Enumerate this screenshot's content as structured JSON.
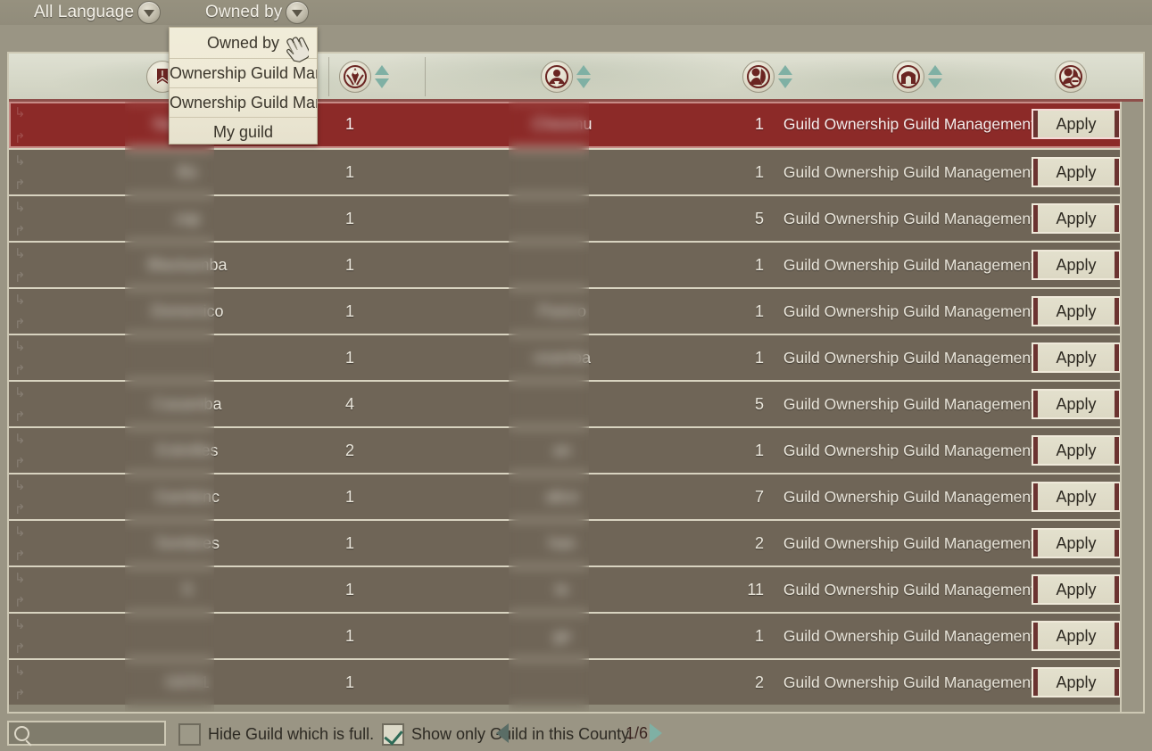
{
  "topbar": {
    "language_filter": {
      "label": "All Language",
      "icon": "chevron-down-icon"
    },
    "owned_by_filter": {
      "label": "Owned by",
      "icon": "chevron-down-icon"
    }
  },
  "dropdown": {
    "open": true,
    "items": [
      {
        "label": "Owned by"
      },
      {
        "label": "Ownership Guild Manag"
      },
      {
        "label": "Ownership Guild Man"
      },
      {
        "label": "My guild"
      }
    ]
  },
  "table": {
    "header": {
      "columns": [
        {
          "icon": "guild-banner-icon",
          "sortable": false
        },
        {
          "icon": "guild-rank-icon",
          "sortable": true
        },
        {
          "icon": "guild-world-icon",
          "sortable": true
        },
        {
          "icon": "guild-members-icon",
          "sortable": true
        },
        {
          "icon": "guild-hall-icon",
          "sortable": true
        },
        {
          "icon": "guild-restricted-icon",
          "sortable": false
        }
      ]
    },
    "apply_label": "Apply",
    "rows": [
      {
        "name": "Noussour",
        "rank": "1",
        "location": "Chesmu",
        "members": "1",
        "desc": "Guild Ownership Guild Management",
        "selected": true
      },
      {
        "name": "Bü",
        "rank": "1",
        "location": "",
        "members": "1",
        "desc": "Guild Ownership Guild Management",
        "selected": false
      },
      {
        "name": "zap",
        "rank": "1",
        "location": "",
        "members": "5",
        "desc": "Guild Ownership Guild Management",
        "selected": false
      },
      {
        "name": "Blackamba",
        "rank": "1",
        "location": "",
        "members": "1",
        "desc": "Guild Ownership Guild Management",
        "selected": false
      },
      {
        "name": "Domenico",
        "rank": "1",
        "location": "Paxico",
        "members": "1",
        "desc": "Guild Ownership Guild Management",
        "selected": false
      },
      {
        "name": "",
        "rank": "1",
        "location": "osamba",
        "members": "1",
        "desc": "Guild Ownership Guild Management",
        "selected": false
      },
      {
        "name": "Casamba",
        "rank": "4",
        "location": "",
        "members": "5",
        "desc": "Guild Ownership Guild Management",
        "selected": false
      },
      {
        "name": "Estrelles",
        "rank": "2",
        "location": "an",
        "members": "1",
        "desc": "Guild Ownership Guild Management",
        "selected": false
      },
      {
        "name": "Gambinc",
        "rank": "1",
        "location": "alice",
        "members": "7",
        "desc": "Guild Ownership Guild Management",
        "selected": false
      },
      {
        "name": "Sombres",
        "rank": "1",
        "location": "han",
        "members": "2",
        "desc": "Guild Ownership Guild Management",
        "selected": false
      },
      {
        "name": "S",
        "rank": "1",
        "location": "te",
        "members": "11",
        "desc": "Guild Ownership Guild Management",
        "selected": false
      },
      {
        "name": "",
        "rank": "1",
        "location": "ge",
        "members": "1",
        "desc": "Guild Ownership Guild Management",
        "selected": false
      },
      {
        "name": "GER1",
        "rank": "1",
        "location": "",
        "members": "2",
        "desc": "Guild Ownership Guild Management",
        "selected": false
      }
    ]
  },
  "bottombar": {
    "search": {
      "value": "",
      "placeholder": "",
      "icon": "search-icon"
    },
    "hide_full": {
      "label": "Hide Guild which is full.",
      "checked": false
    },
    "show_county": {
      "label": "Show only Guild in this County.",
      "checked": true
    },
    "pager": {
      "prev_icon": "triangle-left-icon",
      "page": "1/6",
      "next_icon": "triangle-right-icon"
    }
  },
  "colors": {
    "selected_row": "#8c2a28",
    "row": "#6f6557",
    "panel_border": "#cdc8b4",
    "header_band": "#d6d8c8",
    "accent_teal": "#7fb0a4",
    "crest_red": "#6b2522",
    "page_bg": "#9a9584"
  }
}
